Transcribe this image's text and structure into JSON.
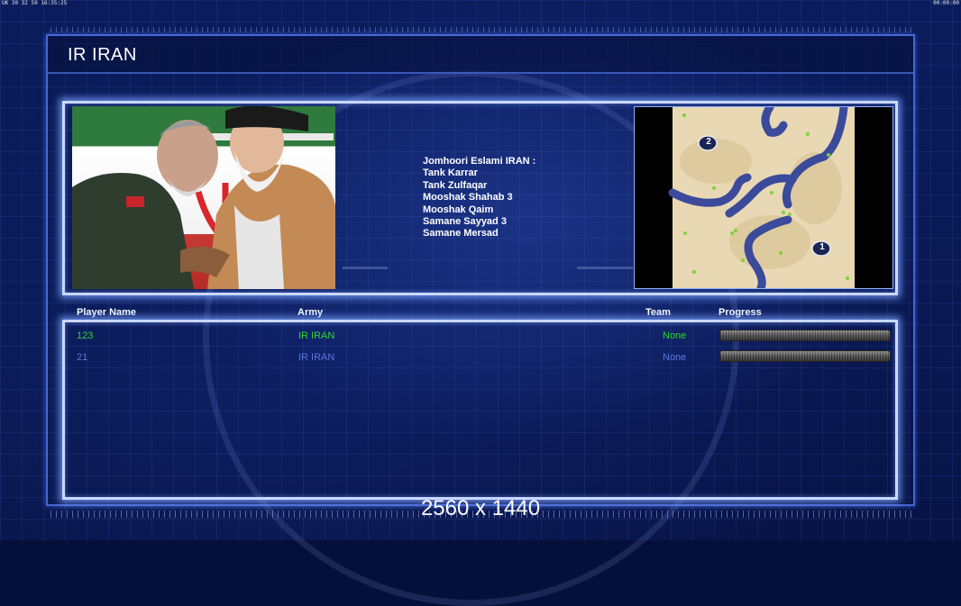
{
  "hud": {
    "left_readout": "UK 30 32 59 16:35:25",
    "right_readout": "00:00:00"
  },
  "page": {
    "title": "IR IRAN"
  },
  "faction": {
    "description_lines": [
      "Jomhoori Eslami IRAN :",
      "Tank Karrar",
      "Tank Zulfaqar",
      "Mooshak Shahab 3",
      "Mooshak Qaim",
      "Samane Sayyad 3",
      "Samane Mersad"
    ]
  },
  "minimap": {
    "start_positions": [
      "1",
      "2"
    ]
  },
  "players_table": {
    "columns": [
      "Player Name",
      "Army",
      "Team",
      "Progress"
    ],
    "rows": [
      {
        "name": "123",
        "army": "IR IRAN",
        "team": "None",
        "progress": 0,
        "color": "#2fd62f"
      },
      {
        "name": "21",
        "army": "IR IRAN",
        "team": "None",
        "progress": 0,
        "color": "#5a78e0"
      }
    ]
  },
  "footer": {
    "resolution": "2560 x 1440"
  },
  "colors": {
    "frame_glow": "#c9d8ff",
    "background": "#0a1a55",
    "player1": "#2fd62f",
    "player2": "#5a78e0"
  }
}
